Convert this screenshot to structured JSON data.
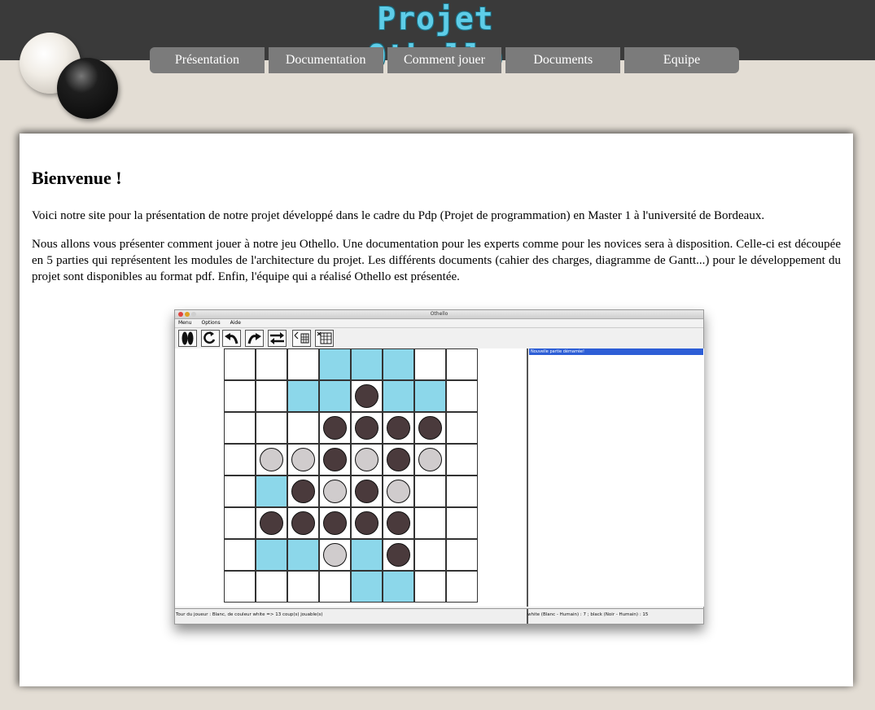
{
  "site": {
    "title": "Projet Othello"
  },
  "nav": {
    "items": [
      {
        "label": "Présentation"
      },
      {
        "label": "Documentation"
      },
      {
        "label": "Comment jouer"
      },
      {
        "label": "Documents"
      },
      {
        "label": "Equipe"
      }
    ]
  },
  "main": {
    "heading": "Bienvenue !",
    "paragraph1": "Voici notre site pour la présentation de notre projet développé dans le cadre du Pdp (Projet de programmation) en Master 1 à l'université de Bordeaux.",
    "paragraph2": "Nous allons vous présenter comment jouer à notre jeu Othello. Une documentation pour les experts comme pour les novices sera à disposition. Celle-ci est découpée en 5 parties qui représentent les modules de l'architecture du projet. Les différents documents (cahier des charges, diagramme de Gantt...) pour le développement du projet sont disponibles au format pdf. Enfin, l'équipe qui a réalisé Othello est présentée."
  },
  "app": {
    "window_title": "Othello",
    "menus": [
      "Menu",
      "Options",
      "Aide"
    ],
    "toolbar_icons": [
      "new-game-icon",
      "restart-icon",
      "undo-icon",
      "redo-icon",
      "swap-icon",
      "board-size-icon",
      "grid-icon"
    ],
    "log_entry": "Nouvelle partie démarrée!",
    "status_left": "Tour du joueur : Blanc, de couleur white => 13 coup(s) jouable(s)",
    "status_right": "white (Blanc - Humain) : 7 ; black (Noir - Humain) : 15",
    "colors": {
      "highlight": "#8cd7ea",
      "black_disk": "#4a3a3c",
      "white_disk": "#d0cccd",
      "log_selection": "#2d5ed6"
    },
    "board": [
      "...HHH..",
      "..HHbHH.",
      "...bbbb.",
      ".wwbwbw.",
      ".Hbwbw..",
      ".bbbbb..",
      ".HHwHb..",
      "....HH.."
    ]
  }
}
